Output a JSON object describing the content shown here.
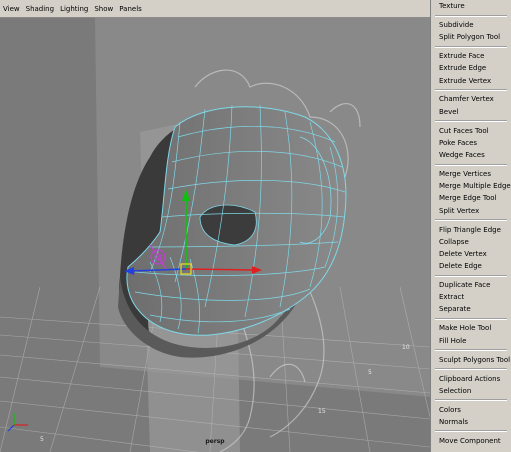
{
  "viewport_menu": [
    "View",
    "Shading",
    "Lighting",
    "Show",
    "Panels"
  ],
  "camera_label": "persp",
  "grid_labels": [
    "10",
    "5",
    "15",
    "5"
  ],
  "side_menu": {
    "groups": [
      [
        "Texture"
      ],
      [
        "Subdivide",
        "Split Polygon Tool"
      ],
      [
        "Extrude Face",
        "Extrude Edge",
        "Extrude Vertex"
      ],
      [
        "Chamfer Vertex",
        "Bevel"
      ],
      [
        "Cut Faces Tool",
        "Poke Faces",
        "Wedge Faces"
      ],
      [
        "Merge Vertices",
        "Merge Multiple Edges",
        "Merge Edge Tool",
        "Split Vertex"
      ],
      [
        "Flip Triangle Edge",
        "Collapse",
        "Delete Vertex",
        "Delete Edge"
      ],
      [
        "Duplicate Face",
        "Extract",
        "Separate"
      ],
      [
        "Make Hole Tool",
        "Fill Hole"
      ],
      [
        "Sculpt Polygons Tool"
      ],
      [
        "Clipboard Actions",
        "Selection"
      ],
      [
        "Colors",
        "Normals"
      ],
      [
        "Move Component"
      ]
    ]
  },
  "colors": {
    "viewport_bg": "#7a7a7a",
    "wireframe": "#7fd8e8",
    "axis_x": "#e02020",
    "axis_y": "#10c010",
    "axis_z": "#2040e0",
    "manipulator_center": "#e8e020",
    "pivot": "#c040d0"
  }
}
